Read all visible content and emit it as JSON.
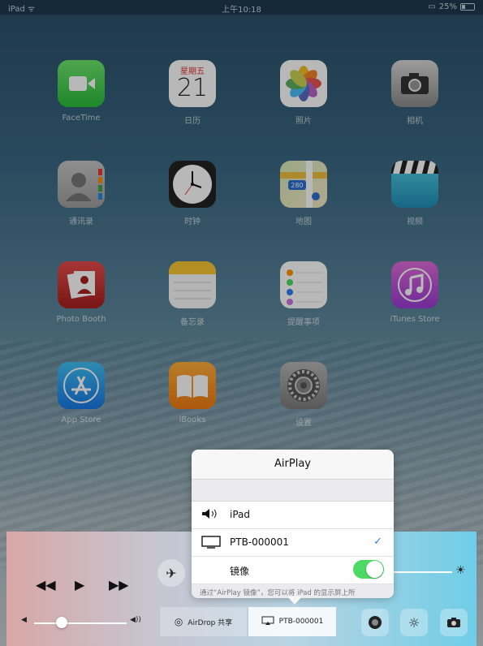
{
  "status_bar": {
    "device": "iPad",
    "time": "上午10:18",
    "battery": "25%"
  },
  "apps": [
    {
      "id": "facetime",
      "label": "FaceTime",
      "icon": "facetime-icon"
    },
    {
      "id": "calendar",
      "label": "日历",
      "icon": "calendar-icon",
      "weekday": "星期五",
      "day": "21"
    },
    {
      "id": "photos",
      "label": "照片",
      "icon": "photos-icon"
    },
    {
      "id": "camera",
      "label": "相机",
      "icon": "camera-icon"
    },
    {
      "id": "contacts",
      "label": "通讯录",
      "icon": "contacts-icon"
    },
    {
      "id": "clock",
      "label": "时钟",
      "icon": "clock-icon"
    },
    {
      "id": "maps",
      "label": "地图",
      "icon": "maps-icon",
      "route": "280"
    },
    {
      "id": "videos",
      "label": "视频",
      "icon": "clapperboard-icon"
    },
    {
      "id": "photobooth",
      "label": "Photo Booth",
      "icon": "photo-booth-icon"
    },
    {
      "id": "notes",
      "label": "备忘录",
      "icon": "notes-icon"
    },
    {
      "id": "reminders",
      "label": "提醒事项",
      "icon": "reminders-icon"
    },
    {
      "id": "itunes",
      "label": "iTunes Store",
      "icon": "music-note-icon"
    },
    {
      "id": "appstore",
      "label": "App Store",
      "icon": "app-store-icon"
    },
    {
      "id": "ibooks",
      "label": "iBooks",
      "icon": "book-icon"
    },
    {
      "id": "settings",
      "label": "设置",
      "icon": "gear-icon"
    }
  ],
  "airplay": {
    "title": "AirPlay",
    "devices": [
      {
        "label": "iPad",
        "icon": "speaker-icon",
        "selected": false
      },
      {
        "label": "PTB-000001",
        "icon": "tv-monitor-icon",
        "selected": true
      }
    ],
    "mirroring_label": "镜像",
    "mirroring_on": true,
    "footer": "通过“AirPlay 镜像”，您可以将 iPad 的显示屏上所"
  },
  "control_center": {
    "volume_level": 0.3,
    "brightness_level": 0.22,
    "airdrop_label": "AirDrop 共享",
    "airplay_target_label": "PTB-000001"
  },
  "colors": {
    "switch_on": "#4cd964",
    "check": "#2f7cf6"
  }
}
